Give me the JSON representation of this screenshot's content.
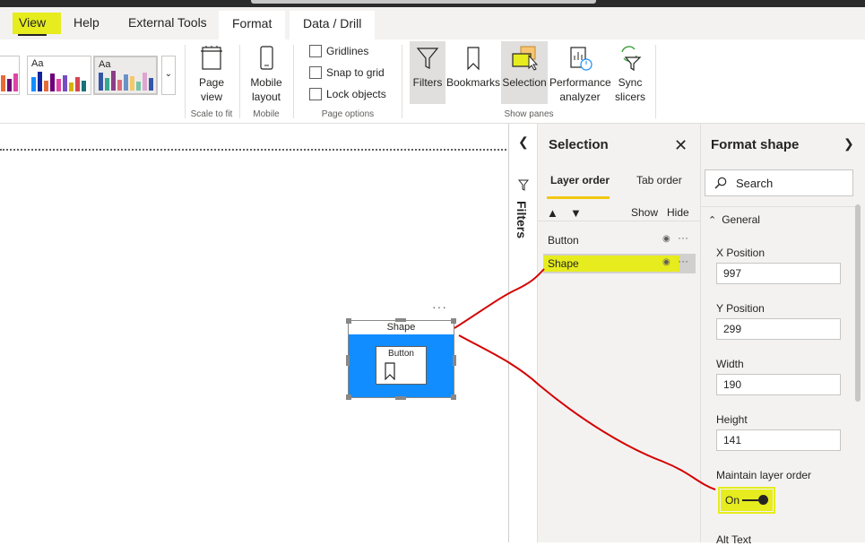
{
  "tabs": [
    {
      "label": "View",
      "active": true
    },
    {
      "label": "Help"
    },
    {
      "label": "External Tools"
    },
    {
      "label": "Format"
    },
    {
      "label": "Data / Drill"
    }
  ],
  "ribbon": {
    "themes": [
      {
        "label": "Aa"
      },
      {
        "label": "Aa"
      },
      {
        "label": "Aa"
      }
    ],
    "page_view": "Page view",
    "mobile_layout": "Mobile layout",
    "scale_group": "Scale to fit",
    "mobile_group": "Mobile",
    "gridlines": "Gridlines",
    "snap_to_grid": "Snap to grid",
    "lock_objects": "Lock objects",
    "page_options_group": "Page options",
    "filters": "Filters",
    "bookmarks": "Bookmarks",
    "selection": "Selection",
    "performance_analyzer": "Performance analyzer",
    "sync_slicers": "Sync slicers",
    "show_panes_group": "Show panes"
  },
  "canvas": {
    "shape_title": "Shape",
    "more_options": "···",
    "button_label": "Button"
  },
  "filters_pane": {
    "label": "Filters"
  },
  "selection_pane": {
    "title": "Selection",
    "tab_layer_order": "Layer order",
    "tab_tab_order": "Tab order",
    "show": "Show",
    "hide": "Hide",
    "items": [
      {
        "label": "Button",
        "selected": false
      },
      {
        "label": "Shape",
        "selected": true
      }
    ]
  },
  "format_pane": {
    "title": "Format shape",
    "search_placeholder": "Search",
    "section": "General",
    "x_position_label": "X Position",
    "x_position": "997",
    "y_position_label": "Y Position",
    "y_position": "299",
    "width_label": "Width",
    "width": "190",
    "height_label": "Height",
    "height": "141",
    "maintain_layer_order_label": "Maintain layer order",
    "maintain_layer_order": "On",
    "alt_text_label": "Alt Text"
  },
  "colors": {
    "highlight": "#e6ec1e",
    "shape_fill": "#118dff",
    "annotation": "#d40000",
    "accent": "#f2c811"
  }
}
